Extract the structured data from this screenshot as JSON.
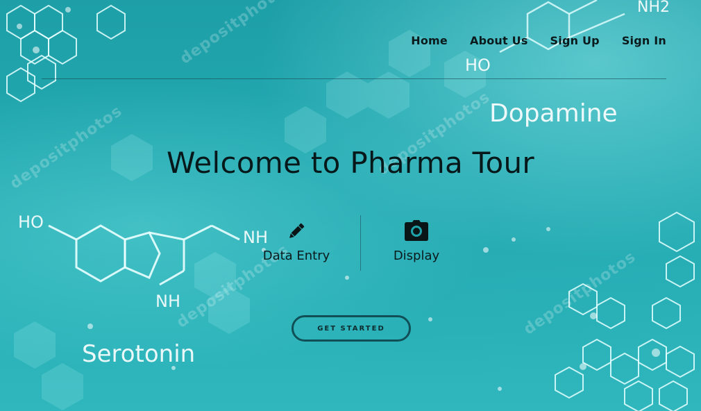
{
  "nav": {
    "items": [
      {
        "label": "Home"
      },
      {
        "label": "About Us"
      },
      {
        "label": "Sign Up"
      },
      {
        "label": "Sign In"
      }
    ]
  },
  "hero": {
    "title": "Welcome to Pharma Tour"
  },
  "features": [
    {
      "label": "Data Entry",
      "icon": "pencil-icon"
    },
    {
      "label": "Display",
      "icon": "camera-icon"
    }
  ],
  "cta": {
    "label": "GET STARTED"
  },
  "background": {
    "labels": [
      "Dopamine",
      "Serotonin",
      "HO",
      "HO",
      "NH",
      "NH",
      "NH2"
    ],
    "watermark": "depositphotos",
    "colors": {
      "base": "#1a9da5",
      "accent": "#0f4f55"
    }
  }
}
